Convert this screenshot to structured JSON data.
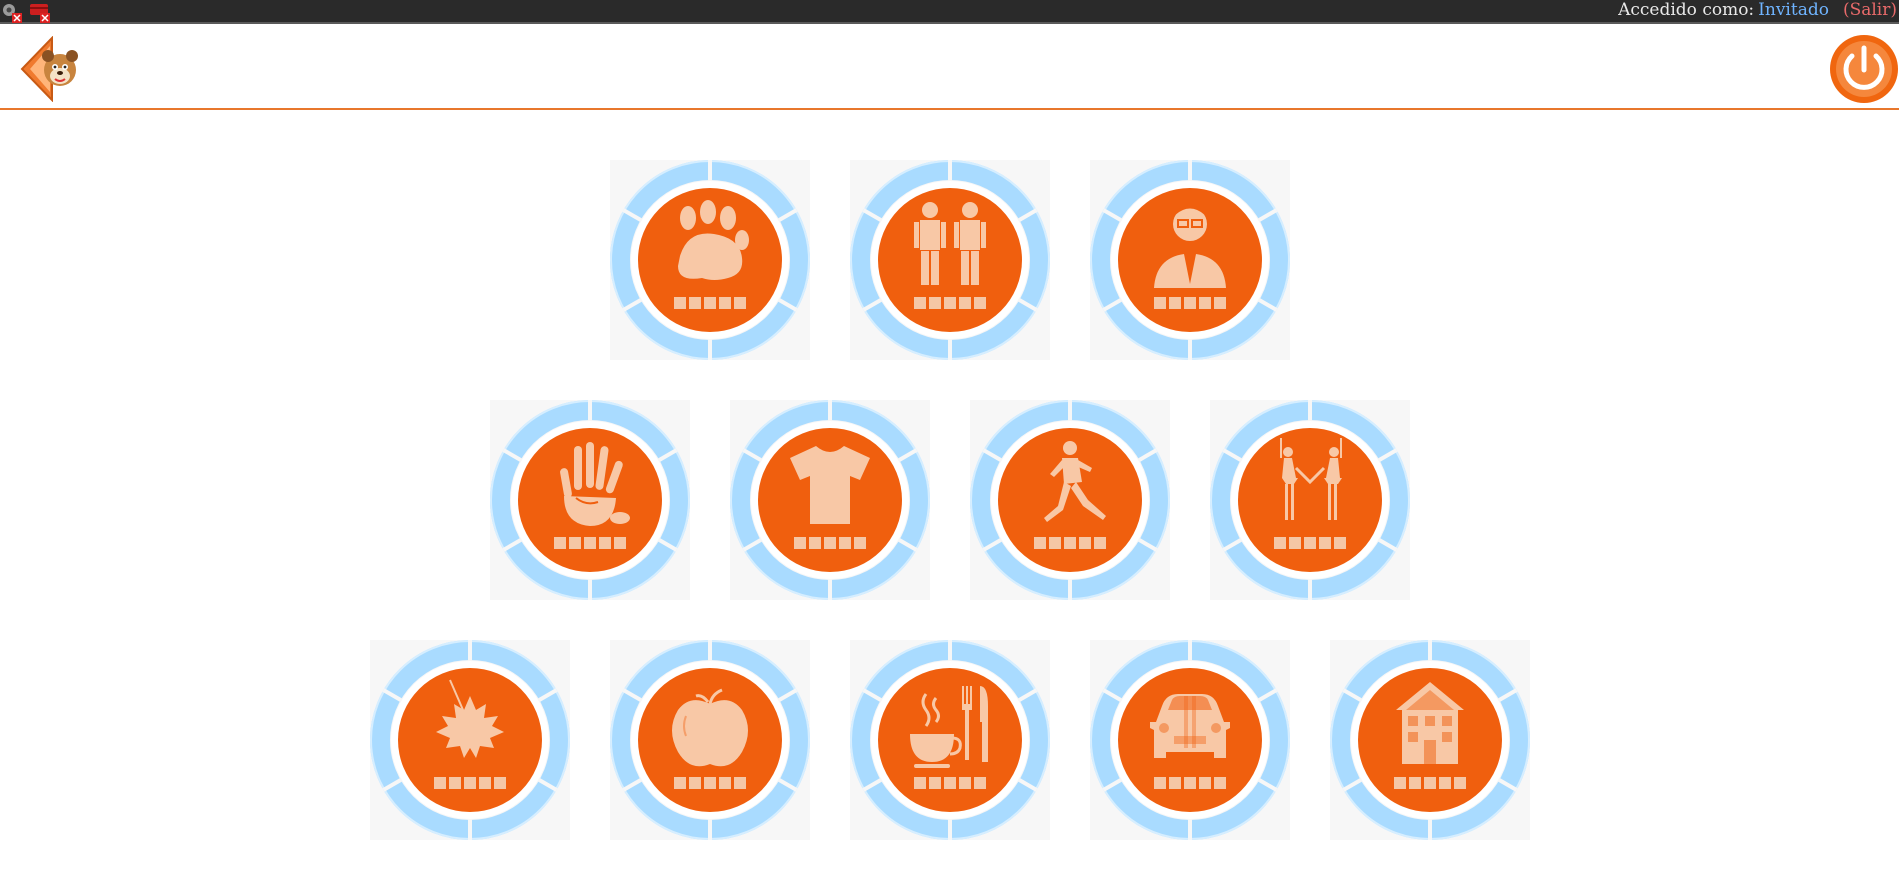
{
  "system_bar": {
    "apps": [
      {
        "icon": "settings-app-icon"
      },
      {
        "icon": "toolbox-app-icon"
      }
    ],
    "status_prefix": "Accedido como:",
    "user_name": "Invitado",
    "logout_label": "(Salir)"
  },
  "header": {
    "back_icon": "mascot-back-arrow-icon",
    "power_icon": "power-icon"
  },
  "colors": {
    "accent": "#f05f0e",
    "ring": "#a9dbff",
    "pictogram": "#f8c8a6",
    "header_rule": "#e8772c"
  },
  "categories": [
    {
      "id": "animals",
      "icon": "paw-print-icon",
      "progress_slots": 5
    },
    {
      "id": "people",
      "icon": "two-people-icon",
      "progress_slots": 5
    },
    {
      "id": "professions",
      "icon": "man-with-glasses-icon",
      "progress_slots": 5
    },
    {
      "id": "body",
      "icon": "hand-icon",
      "progress_slots": 5
    },
    {
      "id": "clothes",
      "icon": "t-shirt-icon",
      "progress_slots": 5
    },
    {
      "id": "sports",
      "icon": "runner-icon",
      "progress_slots": 5
    },
    {
      "id": "dance",
      "icon": "ballet-dancers-icon",
      "progress_slots": 5
    },
    {
      "id": "nature",
      "icon": "maple-leaf-icon",
      "progress_slots": 5
    },
    {
      "id": "food",
      "icon": "apple-icon",
      "progress_slots": 5
    },
    {
      "id": "meals",
      "icon": "cup-and-cutlery-icon",
      "progress_slots": 5
    },
    {
      "id": "transport",
      "icon": "car-icon",
      "progress_slots": 5
    },
    {
      "id": "house",
      "icon": "house-icon",
      "progress_slots": 5
    }
  ]
}
